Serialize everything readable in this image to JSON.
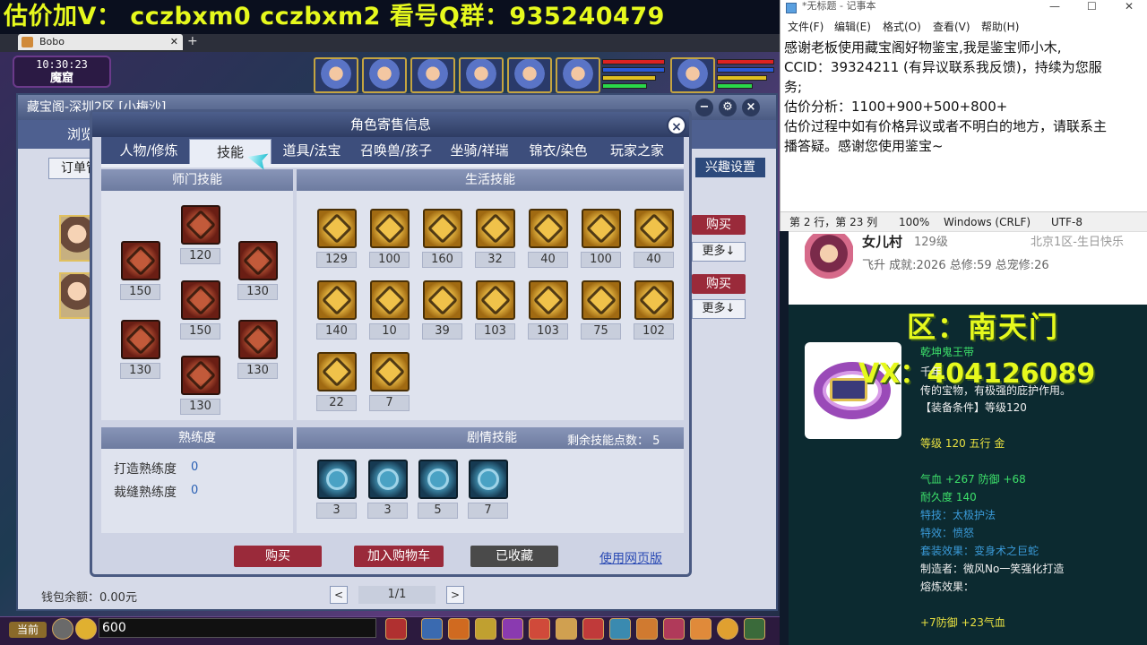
{
  "promo_banner": "估价加V：  cczbxm0   cczbxm2   看号Q群：935240479",
  "game": {
    "browser_tab": "Bobo",
    "new_tab": "+",
    "clock": "10:30:23",
    "location": "魔窟",
    "chat_mode": "当前",
    "chat_input_value": "600",
    "background_window": {
      "title": "藏宝阁-深圳2区 [小梅沙]",
      "nav_label": "浏览",
      "order_label": "订单管",
      "interest_button": "兴趣设置",
      "buy_label": "购买",
      "more_label": "更多↓",
      "wallet_label": "钱包余额：0.00元",
      "page_indicator": "1/1",
      "prev": "<",
      "next": ">"
    }
  },
  "dialog": {
    "title": "角色寄售信息",
    "close": "×",
    "tabs": [
      "人物/修炼",
      "技能",
      "道具/法宝",
      "召唤兽/孩子",
      "坐骑/祥瑞",
      "锦衣/染色",
      "玩家之家"
    ],
    "active_tab": "技能",
    "school_skills": {
      "header": "师门技能",
      "levels": [
        "120",
        "150",
        "130",
        "150",
        "130",
        "130",
        "130"
      ]
    },
    "life_skills": {
      "header": "生活技能",
      "levels": [
        "129",
        "100",
        "160",
        "32",
        "40",
        "100",
        "40",
        "140",
        "10",
        "39",
        "103",
        "103",
        "75",
        "102",
        "22",
        "7"
      ]
    },
    "proficiency": {
      "header": "熟练度",
      "rows": [
        {
          "label": "打造熟练度",
          "value": "0"
        },
        {
          "label": "裁缝熟练度",
          "value": "0"
        }
      ]
    },
    "story_skills": {
      "header": "剧情技能",
      "remaining_label": "剩余技能点数：",
      "remaining_value": "5",
      "levels": [
        "3",
        "3",
        "5",
        "7"
      ]
    },
    "buttons": {
      "buy": "购买",
      "add_cart": "加入购物车",
      "favorited": "已收藏",
      "web": "使用网页版"
    }
  },
  "notepad": {
    "title": "*无标题 - 记事本",
    "menu": [
      "文件(F)",
      "编辑(E)",
      "格式(O)",
      "查看(V)",
      "帮助(H)"
    ],
    "lines": [
      "感谢老板使用藏宝阁好物鉴宝,我是鉴宝师小木,",
      "CCID：39324211 (有异议联系我反馈)，持续为您服",
      "务;",
      "估价分析：1100+900+500+800+",
      "估价过程中如有价格异议或者不明白的地方，请联系主",
      "播答疑。感谢您使用鉴宝~"
    ],
    "status": {
      "position": "第 2 行，第 23 列",
      "zoom": "100%",
      "line_ending": "Windows (CRLF)",
      "encoding": "UTF-8"
    }
  },
  "player": {
    "name": "女儿村",
    "level": "129级",
    "server": "北京1区-生日快乐",
    "stats": "飞升 成就:2026 总修:59 总宠修:26"
  },
  "item": {
    "server_overlay": "区：南天门",
    "vx_overlay": "VX：404126089",
    "name": "乾坤鬼王带",
    "desc_1": "千年",
    "desc_2": "传的宝物，有极强的庇护作用。",
    "requirement": "【装备条件】等级120",
    "level_line": "等级 120  五行 金",
    "stats": "气血 +267  防御 +68",
    "durability": "耐久度 140",
    "special_skill": "特技：太极护法",
    "special_effect": "特效：愤怒",
    "set_effect": "套装效果：变身术之巨蛇",
    "maker": "制造者：微风No一笑强化打造",
    "refine": "熔炼效果：",
    "refine_values": "+7防御 +23气血"
  },
  "colors": {
    "promo_yellow": "#e6f91d",
    "dialog_frame": "#4a5a82",
    "buy_red": "#9a2a3a",
    "item_bg": "#0c2a30"
  }
}
